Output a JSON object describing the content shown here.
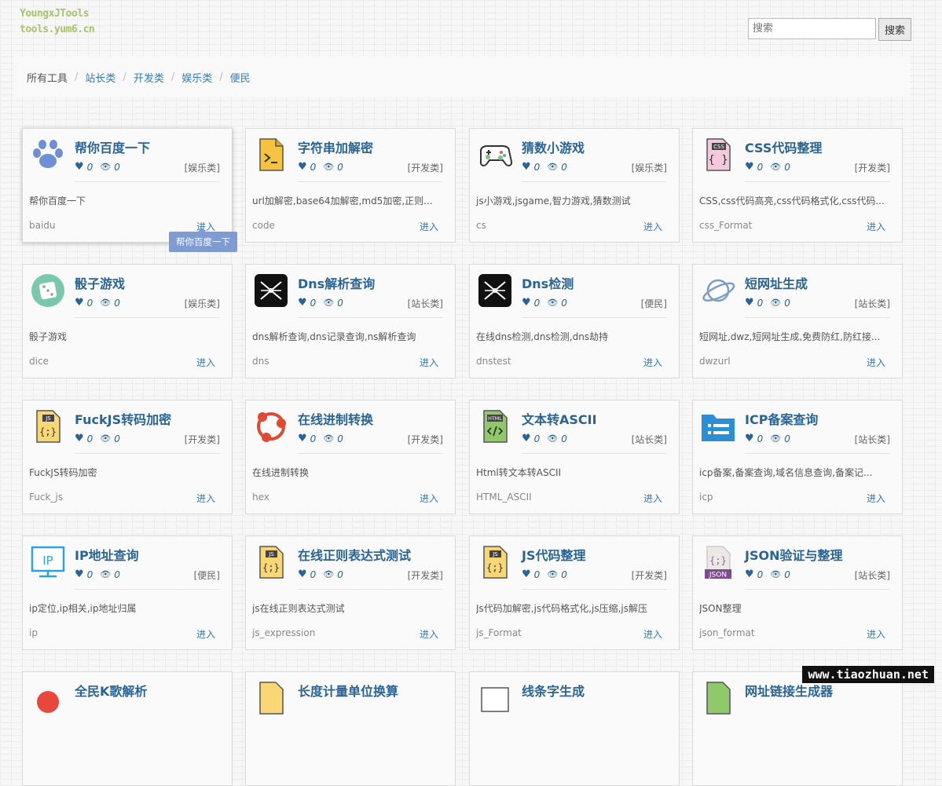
{
  "logo": {
    "line1": "YoungxJTools",
    "line2": "tools.yum6.cn"
  },
  "search": {
    "placeholder": "搜索",
    "button": "搜索"
  },
  "breadcrumb": [
    "所有工具",
    "站长类",
    "开发类",
    "娱乐类",
    "便民"
  ],
  "tooltip": "帮你百度一下",
  "watermark": "www.tiaozhuan.net",
  "tools": [
    {
      "icon": "paw-icon",
      "title": "帮你百度一下",
      "likes": "0",
      "views": "0",
      "category": "[娱乐类]",
      "desc": "帮你百度一下",
      "code": "baidu",
      "enter": "进入"
    },
    {
      "icon": "terminal-file-icon",
      "title": "字符串加解密",
      "likes": "0",
      "views": "0",
      "category": "[开发类]",
      "desc": "url加解密,base64加解密,md5加密,正则...",
      "code": "code",
      "enter": "进入"
    },
    {
      "icon": "gamepad-icon",
      "title": "猜数小游戏",
      "likes": "0",
      "views": "0",
      "category": "[娱乐类]",
      "desc": "js小游戏,jsgame,智力游戏,猜数测试",
      "code": "cs",
      "enter": "进入"
    },
    {
      "icon": "css-file-icon",
      "title": "CSS代码整理",
      "likes": "0",
      "views": "0",
      "category": "[开发类]",
      "desc": "CSS,css代码高亮,css代码格式化,css代码...",
      "code": "css_Format",
      "enter": "进入"
    },
    {
      "icon": "dice-icon",
      "title": "骰子游戏",
      "likes": "0",
      "views": "0",
      "category": "[娱乐类]",
      "desc": "骰子游戏",
      "code": "dice",
      "enter": "进入"
    },
    {
      "icon": "network-icon",
      "title": "Dns解析查询",
      "likes": "0",
      "views": "0",
      "category": "[站长类]",
      "desc": "dns解析查询,dns记录查询,ns解析查询",
      "code": "dns",
      "enter": "进入"
    },
    {
      "icon": "network-icon",
      "title": "Dns检测",
      "likes": "0",
      "views": "0",
      "category": "[便民]",
      "desc": "在线dns检测,dns检测,dns劫持",
      "code": "dnstest",
      "enter": "进入"
    },
    {
      "icon": "planet-icon",
      "title": "短网址生成",
      "likes": "0",
      "views": "0",
      "category": "[站长类]",
      "desc": "短网址,dwz,短网址生成,免费防红,防红接...",
      "code": "dwzurl",
      "enter": "进入"
    },
    {
      "icon": "js-file-icon",
      "title": "FuckJS转码加密",
      "likes": "0",
      "views": "0",
      "category": "[开发类]",
      "desc": "FuckJS转码加密",
      "code": "Fuck_js",
      "enter": "进入"
    },
    {
      "icon": "share-icon",
      "title": "在线进制转换",
      "likes": "0",
      "views": "0",
      "category": "[开发类]",
      "desc": "在线进制转换",
      "code": "hex",
      "enter": "进入"
    },
    {
      "icon": "html-file-icon",
      "title": "文本转ASCII",
      "likes": "0",
      "views": "0",
      "category": "[站长类]",
      "desc": "Html转文本转ASCII",
      "code": "HTML_ASCII",
      "enter": "进入"
    },
    {
      "icon": "folder-list-icon",
      "title": "ICP备案查询",
      "likes": "0",
      "views": "0",
      "category": "[站长类]",
      "desc": "icp备案,备案查询,域名信息查询,备案记...",
      "code": "icp",
      "enter": "进入"
    },
    {
      "icon": "monitor-ip-icon",
      "title": "IP地址查询",
      "likes": "0",
      "views": "0",
      "category": "[便民]",
      "desc": "ip定位,ip相关,ip地址归属",
      "code": "ip",
      "enter": "进入"
    },
    {
      "icon": "js-file-icon",
      "title": "在线正则表达式测试",
      "likes": "0",
      "views": "0",
      "category": "[开发类]",
      "desc": "js在线正则表达式测试",
      "code": "js_expression",
      "enter": "进入"
    },
    {
      "icon": "js-file-icon",
      "title": "JS代码整理",
      "likes": "0",
      "views": "0",
      "category": "[开发类]",
      "desc": "Js代码加解密,js代码格式化,js压缩,js解压",
      "code": "js_Format",
      "enter": "进入"
    },
    {
      "icon": "json-file-icon",
      "title": "JSON验证与整理",
      "likes": "0",
      "views": "0",
      "category": "[站长类]",
      "desc": "JSON整理",
      "code": "json_format",
      "enter": "进入"
    },
    {
      "icon": "music-icon",
      "title": "全民K歌解析",
      "likes": "",
      "views": "",
      "category": "",
      "desc": "",
      "code": "",
      "enter": ""
    },
    {
      "icon": "ruler-icon",
      "title": "长度计量单位换算",
      "likes": "",
      "views": "",
      "category": "",
      "desc": "",
      "code": "",
      "enter": ""
    },
    {
      "icon": "text-icon",
      "title": "线条字生成",
      "likes": "",
      "views": "",
      "category": "",
      "desc": "",
      "code": "",
      "enter": ""
    },
    {
      "icon": "link-icon",
      "title": "网址链接生成器",
      "likes": "",
      "views": "",
      "category": "",
      "desc": "",
      "code": "",
      "enter": ""
    }
  ]
}
